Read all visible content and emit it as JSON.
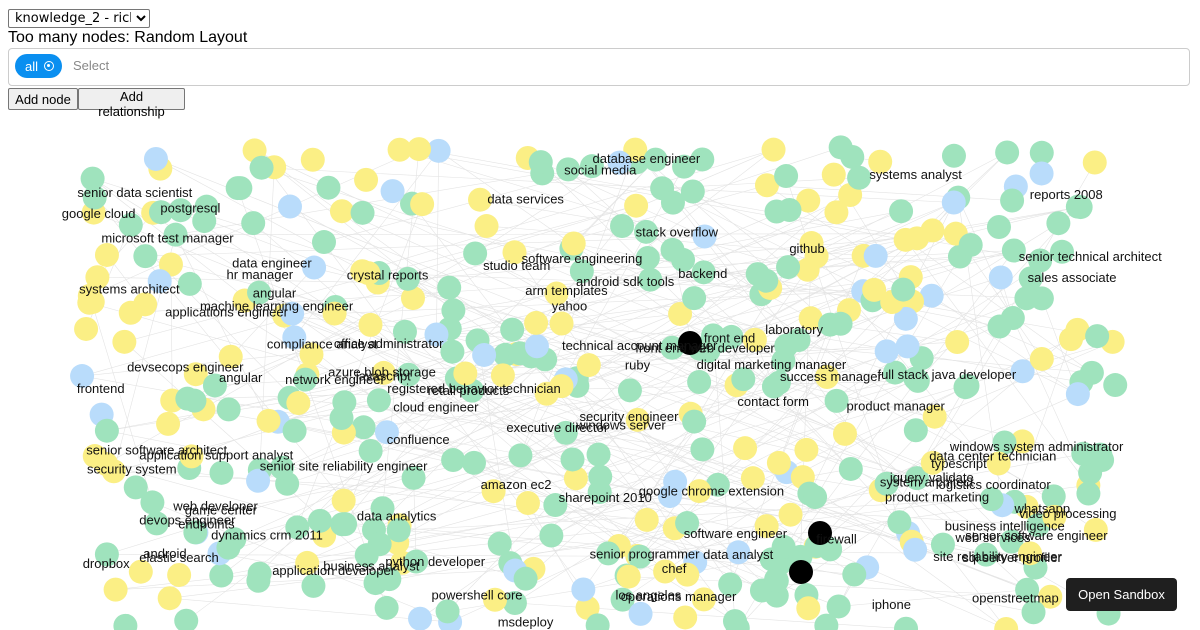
{
  "dataset": {
    "selected": "knowledge_2 - rich_2"
  },
  "layout_title": "Too many nodes: Random Layout",
  "filter": {
    "chip_label": "all",
    "placeholder": "Select"
  },
  "buttons": {
    "add_node": "Add node",
    "add_relationship": "Add relationship",
    "open_sandbox": "Open Sandbox"
  },
  "colors": {
    "green": "#9fe3bd",
    "yellow": "#fbef85",
    "blue": "#b9dcfb",
    "black": "#000000",
    "chip": "#0a8ff0",
    "edge": "#c8c8c8"
  },
  "graph_labels": [
    "front end web developer",
    "systems architect",
    "arm templates",
    "data analytics",
    "openstreetmap",
    "angular",
    "github",
    "powershell core",
    "google chrome extension",
    "video processing",
    "backend",
    "sql server profiler",
    "senior data scientist",
    "senior programmer",
    "ruby",
    "android sdk tools",
    "los angeles",
    "web services",
    "senior site reliability engineer",
    "data analyst",
    "azure blob storage",
    "windows server",
    "sharepoint 2010",
    "systems analyst",
    "web developer",
    "product manager",
    "security engineer",
    "data engineer",
    "machine learning engineer",
    "system architect",
    "software engineer",
    "full stack java developer",
    "executive director",
    "network engineer",
    "business intelligence",
    "data services",
    "office administrator",
    "site reliability engineer",
    "business analyst",
    "senior software engineer",
    "frontend",
    "python developer",
    "devops engineer",
    "registered behavior technician",
    "whatsapp",
    "firewall",
    "social media",
    "dropbox",
    "javascript",
    "database engineer",
    "laboratory",
    "software engineering",
    "contact form",
    "retail products",
    "postgresql",
    "success manager",
    "technical account manager",
    "yahoo",
    "product marketing",
    "application support analyst",
    "studio team",
    "applications engineer",
    "dynamics crm 2011",
    "sales associate",
    "senior technical architect",
    "stack overflow",
    "msdeploy",
    "data center technician",
    "crystal reports",
    "compliance analyst",
    "operations manager",
    "senior software architect",
    "windows system administrator",
    "microsoft test manager",
    "devsecops engineer",
    "jquery validate",
    "game center",
    "cloud engineer",
    "application developer",
    "android",
    "reports 2008",
    "elastic search",
    "hr manager",
    "security system",
    "digital marketing manager",
    "confluence",
    "angular",
    "front end",
    "logistics coordinator",
    "endpoints",
    "iphone",
    "google cloud",
    "amazon ec2",
    "chef",
    "typescript"
  ]
}
